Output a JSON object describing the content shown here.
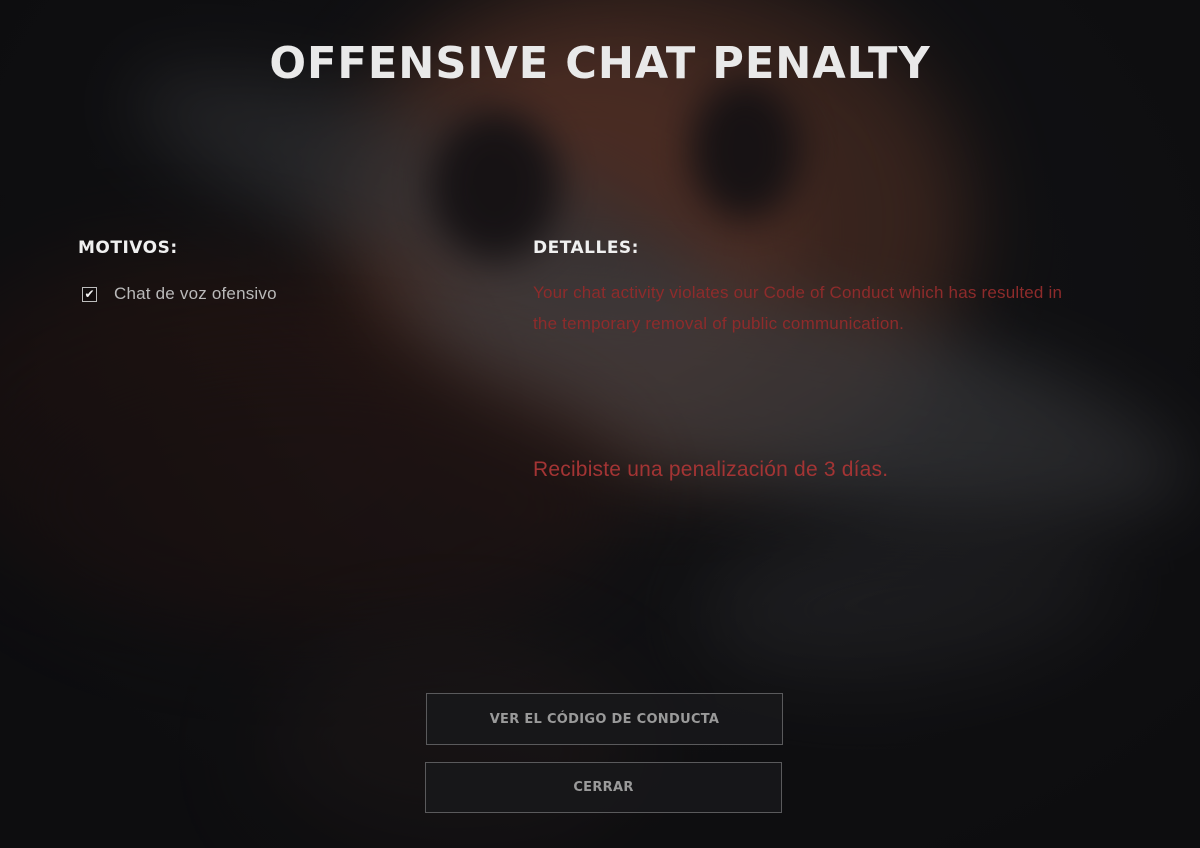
{
  "dialog": {
    "title": "OFFENSIVE CHAT PENALTY"
  },
  "reasons": {
    "heading": "MOTIVOS:",
    "items": [
      {
        "label": "Chat de voz ofensivo",
        "checked": true
      }
    ]
  },
  "details": {
    "heading": "DETALLES:",
    "message": "Your chat activity violates our Code of Conduct which has resulted in the temporary removal of public communication.",
    "penalty": "Recibiste una penalización de 3 días."
  },
  "buttons": {
    "conduct_label": "VER EL CÓDIGO DE CONDUCTA",
    "close_label": "CERRAR"
  },
  "colors": {
    "background": "#131315",
    "title": "#e9e9e9",
    "detail_text": "#8e2b2b",
    "penalty_text": "#a33434",
    "button_border": "#5a5a5c"
  },
  "icons": {
    "checkbox": "checkmark-icon"
  }
}
